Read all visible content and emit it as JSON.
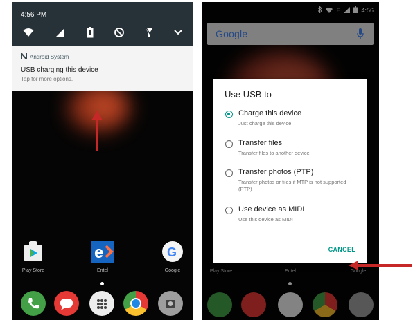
{
  "left_phone": {
    "time": "4:56 PM",
    "quick_settings": [
      "wifi-icon",
      "signal-icon",
      "battery-icon",
      "dnd-off-icon",
      "flashlight-icon",
      "chevron-down-icon"
    ],
    "notification": {
      "app": "Android System",
      "title": "USB charging this device",
      "subtitle": "Tap for more options."
    },
    "apps": [
      {
        "label": "Play Store"
      },
      {
        "label": "Entel"
      },
      {
        "label": "Google"
      }
    ],
    "dock": [
      "phone-icon",
      "messages-icon",
      "app-drawer-icon",
      "chrome-icon",
      "camera-icon"
    ]
  },
  "right_phone": {
    "status_time": "4:56",
    "search_logo": "Google",
    "dialog": {
      "title": "Use USB to",
      "options": [
        {
          "label": "Charge this device",
          "desc": "Just charge this device",
          "selected": true
        },
        {
          "label": "Transfer files",
          "desc": "Transfer files to another device",
          "selected": false
        },
        {
          "label": "Transfer photos (PTP)",
          "desc": "Transfer photos or files if MTP is not supported (PTP)",
          "selected": false
        },
        {
          "label": "Use device as MIDI",
          "desc": "Use this device as MIDI",
          "selected": false
        }
      ],
      "cancel": "CANCEL"
    },
    "apps": [
      {
        "label": "Play Store"
      },
      {
        "label": "Entel"
      },
      {
        "label": "Google"
      }
    ]
  },
  "colors": {
    "accent": "#009688",
    "arrow": "#c62828",
    "qs_bg": "#263238"
  }
}
